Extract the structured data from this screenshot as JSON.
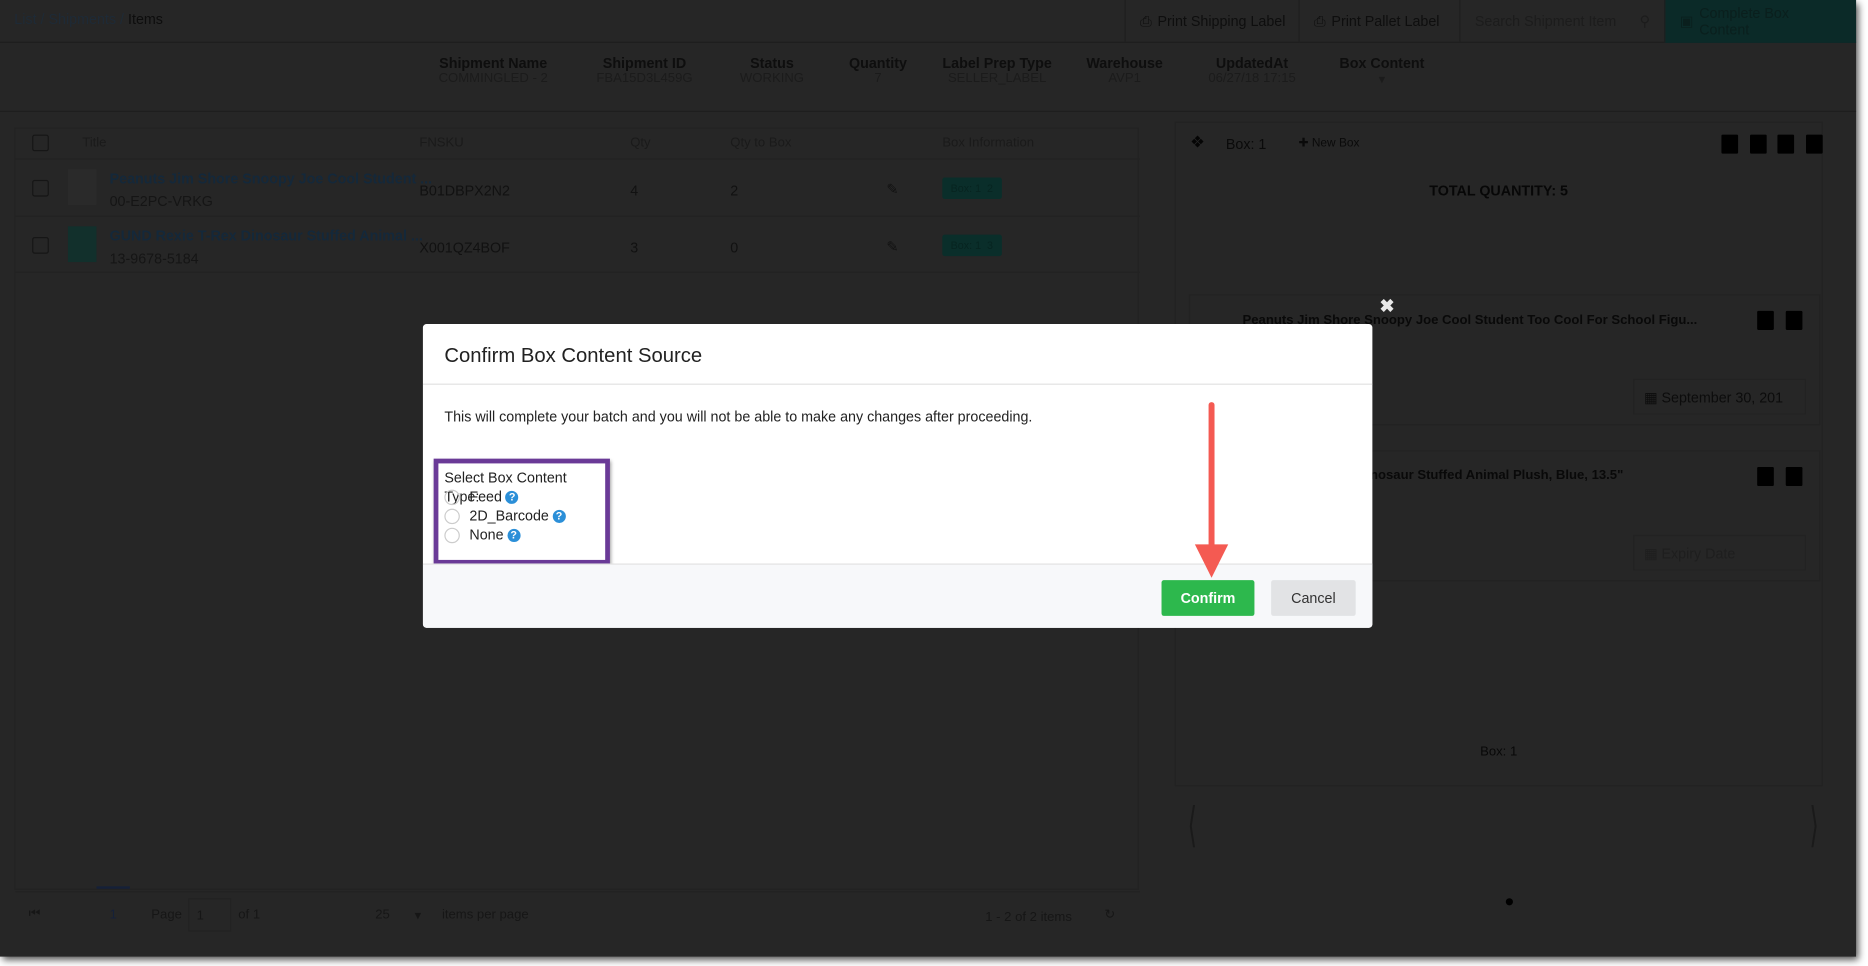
{
  "breadcrumb": {
    "list": "List",
    "shipments": "Shipments",
    "current": "Items",
    "sep": "/"
  },
  "toolbar": {
    "print_shipping": "Print Shipping Label",
    "print_pallet": "Print Pallet Label",
    "search_placeholder": "Search Shipment Item",
    "complete": "Complete Box Content"
  },
  "info": [
    {
      "label": "Shipment Name",
      "value": "COMMINGLED - 2"
    },
    {
      "label": "Shipment ID",
      "value": "FBA15D3L459G"
    },
    {
      "label": "Status",
      "value": "WORKING"
    },
    {
      "label": "Quantity",
      "value": "7"
    },
    {
      "label": "Label Prep Type",
      "value": "SELLER_LABEL"
    },
    {
      "label": "Warehouse",
      "value": "AVP1"
    },
    {
      "label": "UpdatedAt",
      "value": "06/27/18 17:15"
    },
    {
      "label": "Box Content",
      "value": "▾"
    }
  ],
  "table": {
    "headers": [
      "Title",
      "FNSKU",
      "Qty",
      "Qty to Box",
      "Box Information"
    ],
    "rows": [
      {
        "title": "Peanuts Jim Shore Snoopy Joe Cool Student ...",
        "sku": "00-E2PC-VRKG",
        "fnsku": "B01DBPX2N2",
        "qty": "4",
        "qty_to_box": "2",
        "box": "Box: 1",
        "box_qty": "2"
      },
      {
        "title": "GUND Rexie T-Rex Dinosaur Stuffed Animal ...",
        "sku": "13-9678-5184",
        "fnsku": "X001QZ4BOF",
        "qty": "3",
        "qty_to_box": "0",
        "box": "Box: 1",
        "box_qty": "3"
      }
    ]
  },
  "pagination": {
    "current": "1",
    "page_label": "Page",
    "page_value": "1",
    "of": "of 1",
    "per_page": "25",
    "per_page_label": "items per page",
    "summary": "1 - 2 of 2 items"
  },
  "box_panel": {
    "box_label": "Box: 1",
    "new_box": "New Box",
    "total": "TOTAL QUANTITY: 5",
    "items": [
      {
        "title": "Peanuts Jim Shore Snoopy Joe Cool Student Too Cool For School Figu...",
        "date": "September 30, 201"
      },
      {
        "title": "Dinosaur Stuffed Animal Plush, Blue, 13.5\"",
        "date_placeholder": "Expiry Date"
      }
    ],
    "footer_box": "Box: 1"
  },
  "modal": {
    "title": "Confirm Box Content Source",
    "message": "This will complete your batch and you will not be able to make any changes after proceeding.",
    "select_label": "Select Box Content Type:",
    "options": [
      "Feed",
      "2D_Barcode",
      "None"
    ],
    "confirm": "Confirm",
    "cancel": "Cancel",
    "close": "✖"
  },
  "colors": {
    "confirm": "#2db84d",
    "annotation_box": "#6a3a97",
    "arrow": "#f45a52",
    "complete_btn": "#0b2a28"
  }
}
